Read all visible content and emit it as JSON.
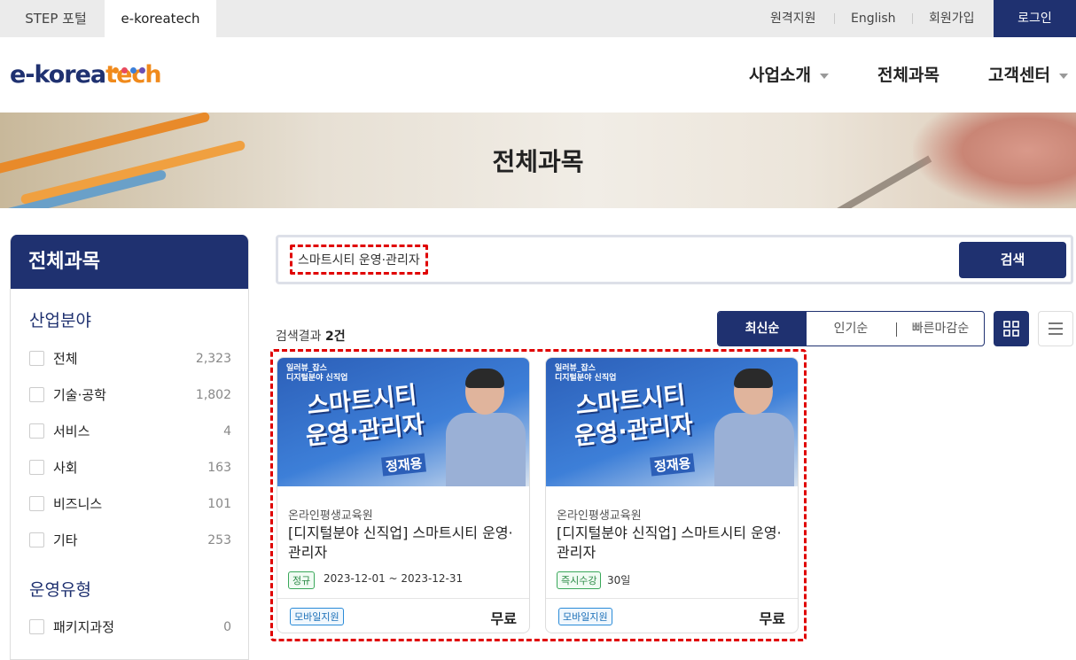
{
  "topbar": {
    "tabs": [
      {
        "label": "STEP 포털"
      },
      {
        "label": "e-koreatech"
      }
    ],
    "links": [
      {
        "label": "원격지원"
      },
      {
        "label": "English"
      },
      {
        "label": "회원가입"
      }
    ],
    "login_label": "로그인"
  },
  "header": {
    "logo_text_a": "e-korea",
    "logo_text_b": "tech",
    "nav": [
      {
        "label": "사업소개"
      },
      {
        "label": "전체과목"
      },
      {
        "label": "고객센터"
      }
    ]
  },
  "banner": {
    "title": "전체과목"
  },
  "sidebar": {
    "title": "전체과목",
    "section1": "산업분야",
    "items": [
      {
        "label": "전체",
        "count": "2,323"
      },
      {
        "label": "기술·공학",
        "count": "1,802"
      },
      {
        "label": "서비스",
        "count": "4"
      },
      {
        "label": "사회",
        "count": "163"
      },
      {
        "label": "비즈니스",
        "count": "101"
      },
      {
        "label": "기타",
        "count": "253"
      }
    ],
    "section2": "운영유형",
    "items2": [
      {
        "label": "패키지과정",
        "count": "0"
      }
    ]
  },
  "search": {
    "query": "스마트시티 운영·관리자",
    "button_label": "검색"
  },
  "results": {
    "prefix": "검색결과 ",
    "count": "2건"
  },
  "sort": {
    "options": [
      {
        "label": "최신순"
      },
      {
        "label": "인기순"
      },
      {
        "label": "빠른마감순"
      }
    ]
  },
  "cards": [
    {
      "thumb_small1": "일러뷰_잡스",
      "thumb_small2": "디지털분야 신직업",
      "thumb_line1": "스마트시티",
      "thumb_line2": "운영·관리자",
      "thumb_name": "정재용",
      "org": "온라인평생교육원",
      "title": "[디지털분야 신직업] 스마트시티 운영·관리자",
      "tag": "정규",
      "period": "2023-12-01 ~ 2023-12-31",
      "mobile": "모바일지원",
      "price": "무료"
    },
    {
      "thumb_small1": "일러뷰_잡스",
      "thumb_small2": "디지털분야 신직업",
      "thumb_line1": "스마트시티",
      "thumb_line2": "운영·관리자",
      "thumb_name": "정재용",
      "org": "온라인평생교육원",
      "title": "[디지털분야 신직업] 스마트시티 운영·관리자",
      "tag": "즉시수강",
      "period": "30일",
      "mobile": "모바일지원",
      "price": "무료"
    }
  ],
  "colors": {
    "brand": "#1f3170",
    "accent_orange": "#f08a1c",
    "highlight_red": "#e00000",
    "tag_green": "#3aa85a",
    "tag_blue": "#2a8bd8"
  },
  "icons": {
    "grid_view": "grid-view-icon",
    "list_view": "list-view-icon",
    "dropdown": "chevron-down-icon"
  }
}
